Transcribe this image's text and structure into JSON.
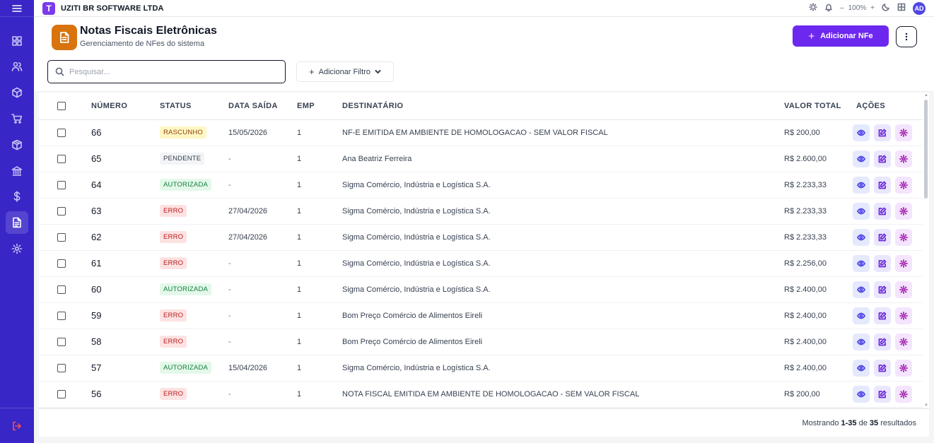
{
  "app": {
    "company": "UZITI BR SOFTWARE LTDA",
    "logo_letter": "T",
    "zoom": "100%",
    "zoom_minus": "–",
    "zoom_plus": "+",
    "avatar_initials": "AD"
  },
  "header": {
    "title": "Notas Fiscais Eletrônicas",
    "subtitle": "Gerenciamento de NFes do sistema",
    "add_label": "Adicionar NFe",
    "add_icon": "+"
  },
  "toolbar": {
    "search_placeholder": "Pesquisar...",
    "search_value": "",
    "filter_label": "Adicionar Filtro",
    "filter_icon": "+"
  },
  "table": {
    "columns": {
      "numero": "NÚMERO",
      "status": "STATUS",
      "data_saida": "DATA SAÍDA",
      "emp": "EMP",
      "destinatario": "DESTINATÁRIO",
      "valor_total": "VALOR TOTAL",
      "acoes": "AÇÕES"
    },
    "rows": [
      {
        "numero": "66",
        "status": "RASCUNHO",
        "status_key": "rascunho",
        "data_saida": "15/05/2026",
        "emp": "1",
        "destinatario": "NF-E EMITIDA EM AMBIENTE DE HOMOLOGACAO - SEM VALOR FISCAL",
        "valor_total": "R$ 200,00"
      },
      {
        "numero": "65",
        "status": "PENDENTE",
        "status_key": "pendente",
        "data_saida": "-",
        "emp": "1",
        "destinatario": "Ana Beatriz Ferreira",
        "valor_total": "R$ 2.600,00"
      },
      {
        "numero": "64",
        "status": "AUTORIZADA",
        "status_key": "autorizada",
        "data_saida": "-",
        "emp": "1",
        "destinatario": "Sigma Comércio, Indústria e Logística S.A.",
        "valor_total": "R$ 2.233,33"
      },
      {
        "numero": "63",
        "status": "ERRO",
        "status_key": "erro",
        "data_saida": "27/04/2026",
        "emp": "1",
        "destinatario": "Sigma Comércio, Indústria e Logística S.A.",
        "valor_total": "R$ 2.233,33"
      },
      {
        "numero": "62",
        "status": "ERRO",
        "status_key": "erro",
        "data_saida": "27/04/2026",
        "emp": "1",
        "destinatario": "Sigma Comércio, Indústria e Logística S.A.",
        "valor_total": "R$ 2.233,33"
      },
      {
        "numero": "61",
        "status": "ERRO",
        "status_key": "erro",
        "data_saida": "-",
        "emp": "1",
        "destinatario": "Sigma Comércio, Indústria e Logística S.A.",
        "valor_total": "R$ 2.256,00"
      },
      {
        "numero": "60",
        "status": "AUTORIZADA",
        "status_key": "autorizada",
        "data_saida": "-",
        "emp": "1",
        "destinatario": "Sigma Comércio, Indústria e Logística S.A.",
        "valor_total": "R$ 2.400,00"
      },
      {
        "numero": "59",
        "status": "ERRO",
        "status_key": "erro",
        "data_saida": "-",
        "emp": "1",
        "destinatario": "Bom Preço Comércio de Alimentos Eireli",
        "valor_total": "R$ 2.400,00"
      },
      {
        "numero": "58",
        "status": "ERRO",
        "status_key": "erro",
        "data_saida": "-",
        "emp": "1",
        "destinatario": "Bom Preço Comércio de Alimentos Eireli",
        "valor_total": "R$ 2.400,00"
      },
      {
        "numero": "57",
        "status": "AUTORIZADA",
        "status_key": "autorizada",
        "data_saida": "15/04/2026",
        "emp": "1",
        "destinatario": "Sigma Comércio, Indústria e Logística S.A.",
        "valor_total": "R$ 2.400,00"
      },
      {
        "numero": "56",
        "status": "ERRO",
        "status_key": "erro",
        "data_saida": "-",
        "emp": "1",
        "destinatario": "NOTA FISCAL EMITIDA EM AMBIENTE DE HOMOLOGACAO - SEM VALOR FISCAL",
        "valor_total": "R$ 200,00"
      }
    ]
  },
  "footer": {
    "prefix": "Mostrando",
    "range": "1-35",
    "middle": "de",
    "total": "35",
    "suffix": "resultados"
  },
  "sidebar": {
    "items": [
      {
        "icon": "dashboard-icon"
      },
      {
        "icon": "users-icon"
      },
      {
        "icon": "box-icon"
      },
      {
        "icon": "cart-icon"
      },
      {
        "icon": "package-icon"
      },
      {
        "icon": "bank-icon"
      },
      {
        "icon": "dollar-icon"
      },
      {
        "icon": "document-icon",
        "active": true
      },
      {
        "icon": "settings-icon"
      }
    ],
    "logout_icon": "logout-icon"
  },
  "colors": {
    "sidebar": "#3826c7",
    "primary": "#6d28f0",
    "header_icon": "#d9730d"
  }
}
